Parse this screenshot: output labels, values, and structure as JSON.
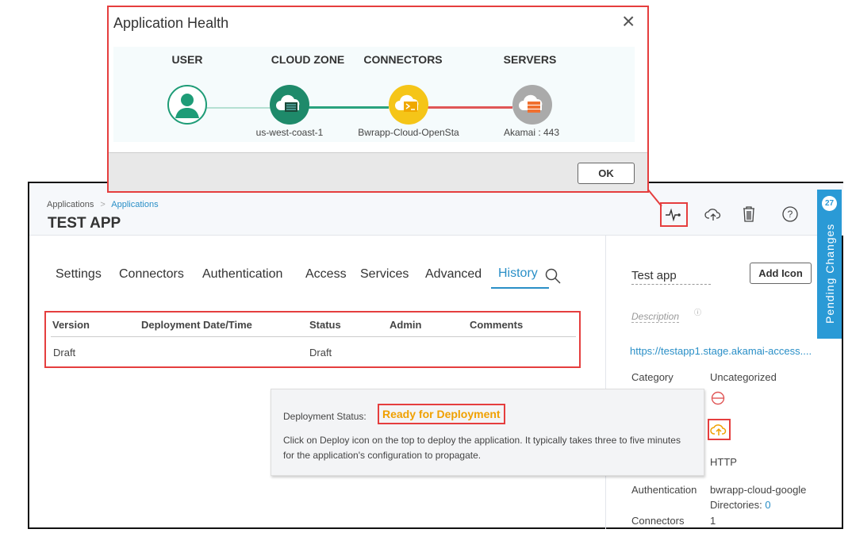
{
  "modal": {
    "title": "Application Health",
    "close": "×",
    "ok": "OK",
    "columns": [
      "USER",
      "CLOUD ZONE",
      "CONNECTORS",
      "SERVERS"
    ],
    "nodes": [
      {
        "label": "",
        "icon": "user-icon",
        "color": "#1e9c77"
      },
      {
        "label": "us-west-coast-1",
        "icon": "cloud-zone-icon",
        "color": "#1e8a6a"
      },
      {
        "label": "Bwrapp-Cloud-OpenSta",
        "icon": "connector-icon",
        "color": "#f5c518"
      },
      {
        "label": "Akamai : 443",
        "icon": "server-icon",
        "color": "#aaaaaa"
      }
    ],
    "links": [
      {
        "color": "#b5e0d2"
      },
      {
        "color": "#2aa37e"
      },
      {
        "color": "#e05656"
      }
    ]
  },
  "breadcrumb": {
    "root": "Applications",
    "sep": ">",
    "current": "Applications"
  },
  "page_title": "TEST APP",
  "toolbar": {
    "health": "health-icon",
    "deploy": "cloud-upload-icon",
    "delete": "trash-icon",
    "help": "help-icon"
  },
  "tabs": [
    "Settings",
    "Connectors",
    "Authentication",
    "Access",
    "Services",
    "Advanced",
    "History"
  ],
  "active_tab": "History",
  "history": {
    "headers": [
      "Version",
      "Deployment Date/Time",
      "Status",
      "Admin",
      "Comments"
    ],
    "rows": [
      [
        "Draft",
        "",
        "Draft",
        "",
        ""
      ]
    ]
  },
  "tooltip": {
    "label": "Deployment Status:",
    "status": "Ready for Deployment",
    "text": "Click on Deploy icon on the top to deploy the application. It typically takes three to five minutes for the application's configuration to propagate."
  },
  "side": {
    "name": "Test app",
    "add_icon": "Add Icon",
    "description_placeholder": "Description",
    "url": "https://testapp1.stage.akamai-access....",
    "category_label": "Category",
    "category": "Uncategorized",
    "protocol": "HTTP",
    "auth_label": "Authentication",
    "auth": "bwrapp-cloud-google",
    "directories_label": "Directories:",
    "directories": "0",
    "connectors_label": "Connectors",
    "connectors": "1"
  },
  "pending": {
    "label": "Pending Changes",
    "count": "27"
  }
}
